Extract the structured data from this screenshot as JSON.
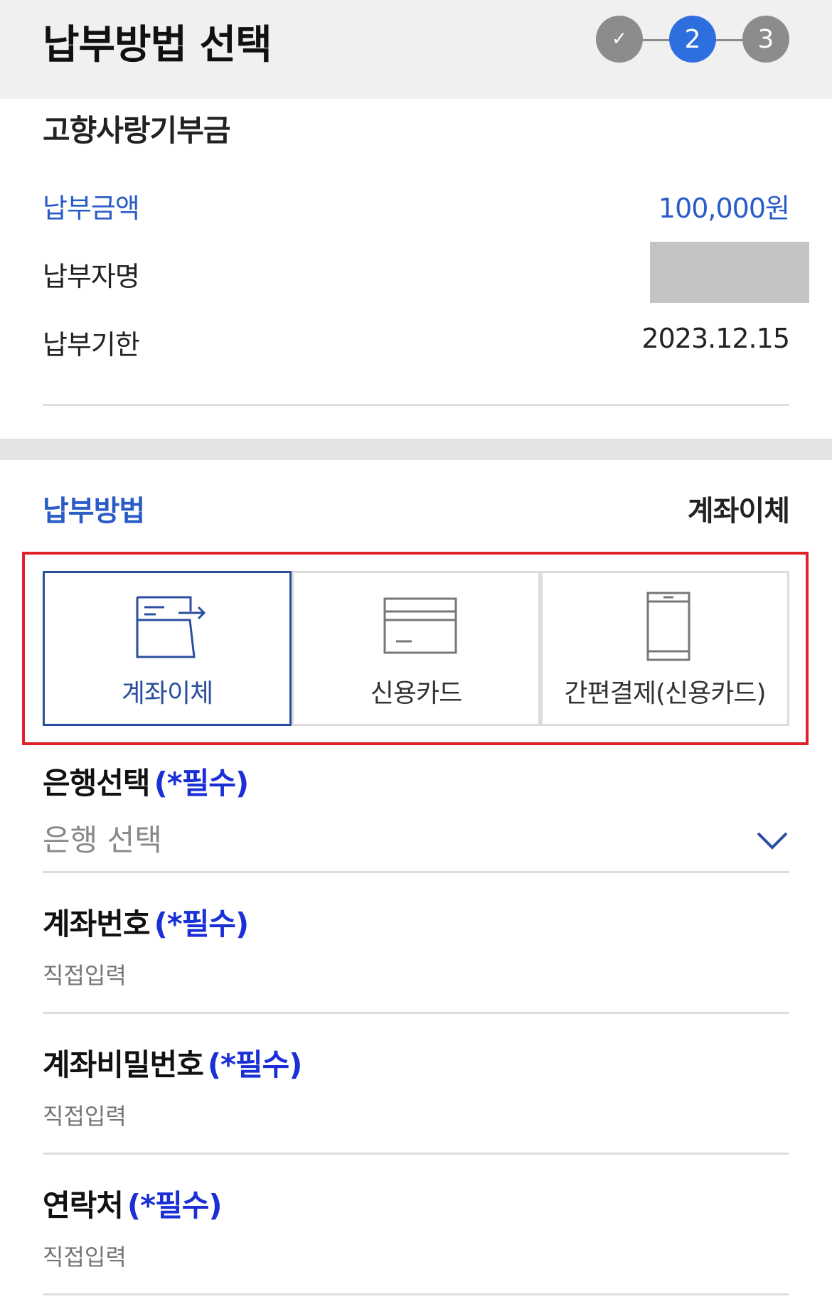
{
  "header": {
    "title": "납부방법 선택",
    "steps": [
      {
        "label": "✓",
        "state": "done"
      },
      {
        "label": "2",
        "state": "current"
      },
      {
        "label": "3",
        "state": "upcoming"
      }
    ]
  },
  "summary": {
    "fund_name": "고향사랑기부금",
    "amount_label": "납부금액",
    "amount_value": "100,000원",
    "payer_label": "납부자명",
    "deadline_label": "납부기한",
    "deadline_value": "2023.12.15"
  },
  "payment_method": {
    "label": "납부방법",
    "selected_value": "계좌이체",
    "options": [
      {
        "label": "계좌이체",
        "icon": "bank-transfer-icon",
        "selected": true
      },
      {
        "label": "신용카드",
        "icon": "credit-card-icon",
        "selected": false
      },
      {
        "label": "간편결제(신용카드)",
        "icon": "mobile-pay-icon",
        "selected": false
      }
    ]
  },
  "form": {
    "required_tag": "(*필수)",
    "bank": {
      "label": "은행선택",
      "placeholder": "은행 선택"
    },
    "account_number": {
      "label": "계좌번호",
      "placeholder": "직접입력"
    },
    "account_password": {
      "label": "계좌비밀번호",
      "placeholder": "직접입력"
    },
    "contact": {
      "label": "연락처",
      "placeholder": "직접입력"
    }
  },
  "colors": {
    "accent_blue": "#2a5cc7",
    "required_blue": "#1a2fd6",
    "step_current": "#2e6fe0",
    "step_inactive": "#8c8c8c",
    "highlight_red": "#e0202a",
    "selected_border": "#2b4f9e"
  }
}
